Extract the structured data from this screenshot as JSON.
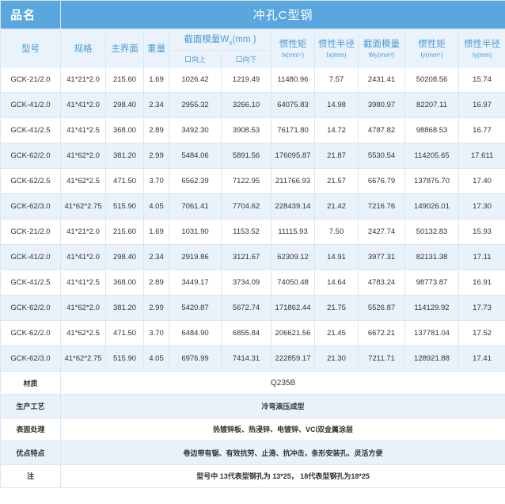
{
  "table": {
    "name_label": "品名",
    "product_title": "冲孔C型钢",
    "headers": {
      "model": "型号",
      "spec": "规格",
      "area": "主界面",
      "weight": "重量",
      "section_modulus_w": "截面模量W",
      "section_modulus_w_sub": "x",
      "section_modulus_unit": "(mm )",
      "upward": "口向上",
      "downward": "口向下",
      "inertia_x": "惯性矩",
      "inertia_x_unit": "Ix(mm⁴)",
      "radius_x": "惯性半径",
      "radius_x_unit": "Ix(mm)",
      "modulus_y": "截面模量",
      "modulus_y_unit": "Wy(mm³)",
      "inertia_y": "惯性矩",
      "inertia_y_unit": "Iy(mm⁴)",
      "radius_y": "惯性半径",
      "radius_y_unit": "Iy(mm)"
    },
    "rows": [
      [
        "GCK-21/2.0",
        "41*21*2.0",
        "215.60",
        "1.69",
        "1026.42",
        "1219.49",
        "11480.96",
        "7.57",
        "2431.41",
        "50208.56",
        "15.74"
      ],
      [
        "GCK-41/2.0",
        "41*41*2.0",
        "298.40",
        "2.34",
        "2955.32",
        "3266.10",
        "64075.83",
        "14.98",
        "3980.97",
        "82207.11",
        "16.97"
      ],
      [
        "GCK-41/2.5",
        "41*41*2.5",
        "368.00",
        "2.89",
        "3492.30",
        "3908.53",
        "76171.80",
        "14.72",
        "4787.82",
        "98868.53",
        "16.77"
      ],
      [
        "GCK-62/2.0",
        "41*62*2.0",
        "381.20",
        "2.99",
        "5484.06",
        "5891.56",
        "176095.87",
        "21.87",
        "5530.54",
        "114205.65",
        "17.611"
      ],
      [
        "GCK-62/2.5",
        "41*62*2.5",
        "471.50",
        "3.70",
        "6562.39",
        "7122.95",
        "211766.93",
        "21.57",
        "6676.79",
        "137875.70",
        "17.40"
      ],
      [
        "GCK-62/3.0",
        "41*62*2.75",
        "515.90",
        "4.05",
        "7061.41",
        "7704.62",
        "228439.14",
        "21.42",
        "7216.76",
        "149026.01",
        "17.30"
      ],
      [
        "GCK-21/2.0",
        "41*21*2.0",
        "215.60",
        "1.69",
        "1031.90",
        "1153.52",
        "11115.93",
        "7.50",
        "2427.74",
        "50132.83",
        "15.93"
      ],
      [
        "GCK-41/2.0",
        "41*41*2.0",
        "298.40",
        "2.34",
        "2919.86",
        "3121.67",
        "62309.12",
        "14.91",
        "3977.31",
        "82131.38",
        "17.11"
      ],
      [
        "GCK-41/2.5",
        "41*41*2.5",
        "368.00",
        "2.89",
        "3449.17",
        "3734.09",
        "74050.48",
        "14.64",
        "4783.24",
        "98773.87",
        "16.91"
      ],
      [
        "GCK-62/2.0",
        "41*62*2.0",
        "381.20",
        "2.99",
        "5420.87",
        "5672.74",
        "171862.44",
        "21.75",
        "5526.87",
        "114129.92",
        "17.73"
      ],
      [
        "GCK-62/2.0",
        "41*62*2.5",
        "471.50",
        "3.70",
        "6484.90",
        "6855.84",
        "206621.56",
        "21.45",
        "6672.21",
        "137781.04",
        "17.52"
      ],
      [
        "GCK-62/3.0",
        "41*62*2.75",
        "515.90",
        "4.05",
        "6976.99",
        "7414.31",
        "222859.17",
        "21.30",
        "7211.71",
        "128921.88",
        "17.41"
      ]
    ],
    "footer": [
      {
        "label": "材质",
        "value": "Q235B"
      },
      {
        "label": "生产工艺",
        "value": "冷弯滚压成型"
      },
      {
        "label": "表面处理",
        "value": "热镀锌板、热浸锌、电镀锌、VCI双金属涂层"
      },
      {
        "label": "优点特点",
        "value": "卷边带有锯、有效抗劳、止滑、抗冲击，条形安装孔、灵活方便"
      },
      {
        "label": "注",
        "value": "型号中 13代表型钢孔为 13*25， 18代表型钢孔为18*25"
      }
    ]
  },
  "colors": {
    "header_bar": "#5aa7df",
    "header_text": "#4a9ad6",
    "row_alt": "#e9f2fb",
    "border": "#d9e6f1"
  }
}
